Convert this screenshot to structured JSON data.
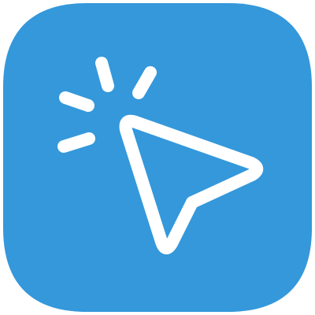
{
  "icon": {
    "name": "click-cursor-app-icon",
    "background_color": "#3498DB",
    "glyph_color": "#FFFFFF"
  }
}
